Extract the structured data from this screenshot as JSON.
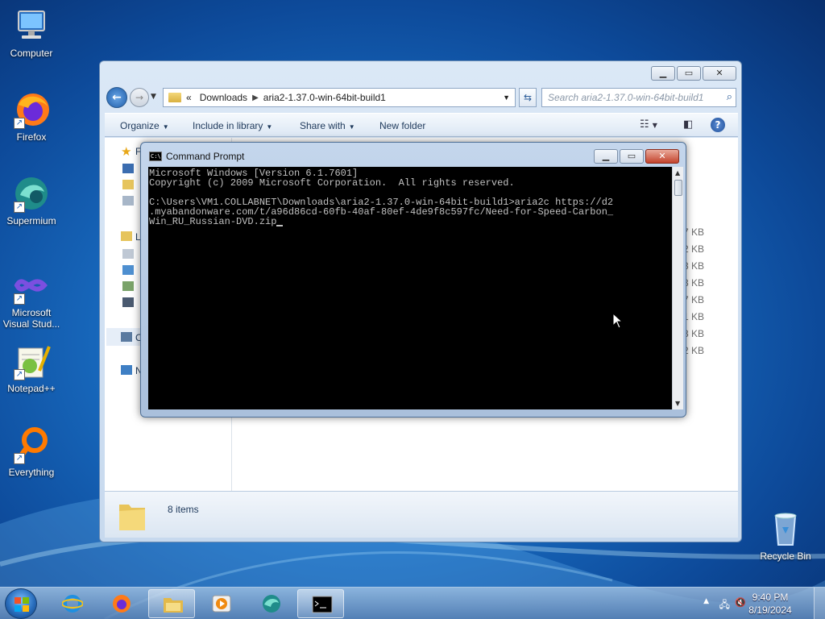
{
  "desktop": {
    "icons": [
      {
        "label": "Computer"
      },
      {
        "label": "Firefox"
      },
      {
        "label": "Supermium"
      },
      {
        "label": "Microsoft Visual Stud..."
      },
      {
        "label": "Notepad++"
      },
      {
        "label": "Everything"
      },
      {
        "label": "Recycle Bin"
      }
    ]
  },
  "explorer": {
    "breadcrumb_prefix": "«",
    "breadcrumb": [
      "Downloads",
      "aria2-1.37.0-win-64bit-build1"
    ],
    "search_placeholder": "Search aria2-1.37.0-win-64bit-build1",
    "toolbar": {
      "organize": "Organize",
      "include_in_library": "Include in library",
      "share_with": "Share with",
      "new_folder": "New folder"
    },
    "nav_letters": [
      "F",
      "L",
      "C",
      "N"
    ],
    "sizes": [
      "7 KB",
      "2 KB",
      "3 KB",
      "3 KB",
      "7 KB",
      "1 KB",
      "3 KB",
      "2 KB"
    ],
    "status": "8 items"
  },
  "cmd": {
    "title": "Command Prompt",
    "lines": [
      "Microsoft Windows [Version 6.1.7601]",
      "Copyright (c) 2009 Microsoft Corporation.  All rights reserved.",
      "",
      "C:\\Users\\VM1.COLLABNET\\Downloads\\aria2-1.37.0-win-64bit-build1>aria2c https://d2",
      ".myabandonware.com/t/a96d86cd-60fb-40af-80ef-4de9f8c597fc/Need-for-Speed-Carbon_",
      "Win_RU_Russian-DVD.zip"
    ]
  },
  "taskbar": {
    "time": "9:40 PM",
    "date": "8/19/2024",
    "apps": [
      "internet-explorer",
      "firefox",
      "file-explorer",
      "media-player",
      "supermium",
      "command-prompt"
    ]
  }
}
